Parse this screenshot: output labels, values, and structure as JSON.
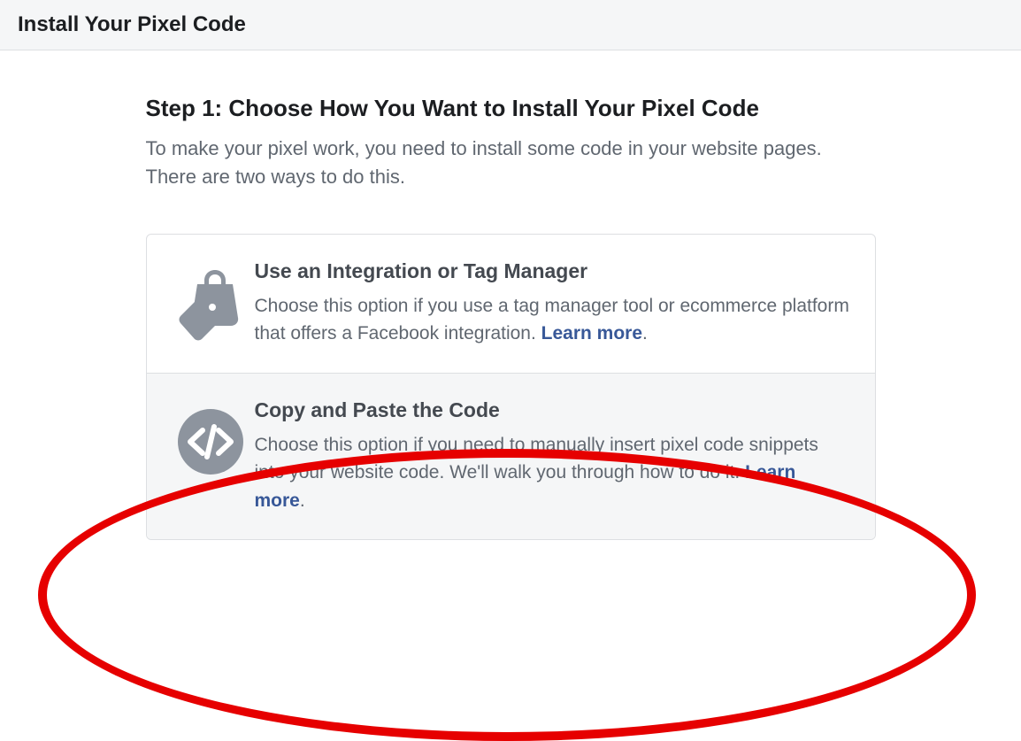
{
  "header": {
    "title": "Install Your Pixel Code"
  },
  "step": {
    "heading": "Step 1: Choose How You Want to Install Your Pixel Code",
    "subtext": "To make your pixel work, you need to install some code in your website pages. There are two ways to do this."
  },
  "options": [
    {
      "title": "Use an Integration or Tag Manager",
      "desc": "Choose this option if you use a tag manager tool or ecommerce platform that offers a Facebook integration. ",
      "learn_more": "Learn more",
      "period": "."
    },
    {
      "title": "Copy and Paste the Code",
      "desc": "Choose this option if you need to manually insert pixel code snippets into your website code. We'll walk you through how to do it. ",
      "learn_more": "Learn more",
      "period": "."
    }
  ]
}
